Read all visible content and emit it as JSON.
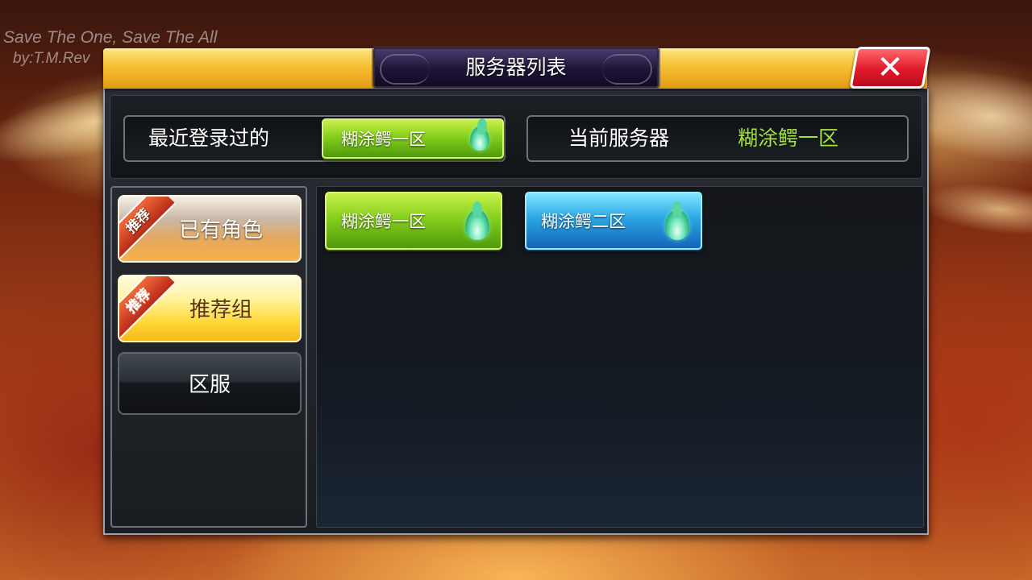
{
  "watermark": {
    "line1": "Save The One, Save The All",
    "line2": "by:T.M.Rev"
  },
  "window": {
    "title": "服务器列表",
    "close_label": "✕"
  },
  "recent": {
    "label": "最近登录过的",
    "server": "糊涂鳄一区",
    "icon": "flame-icon"
  },
  "current": {
    "label": "当前服务器",
    "server": "糊涂鳄一区"
  },
  "categories": [
    {
      "label": "已有角色",
      "badge": "推荐"
    },
    {
      "label": "推荐组",
      "badge": "推荐"
    },
    {
      "label": "区服"
    }
  ],
  "servers": [
    {
      "name": "糊涂鳄一区",
      "status_color": "green",
      "icon": "flame-icon"
    },
    {
      "name": "糊涂鳄二区",
      "status_color": "blue",
      "icon": "flame-icon"
    }
  ],
  "colors": {
    "title_bar": "#f7c33a",
    "close": "#e0192a",
    "server_green": "#86cf1c",
    "server_blue": "#2ba6e4",
    "current_server_text": "#a2e23a"
  }
}
